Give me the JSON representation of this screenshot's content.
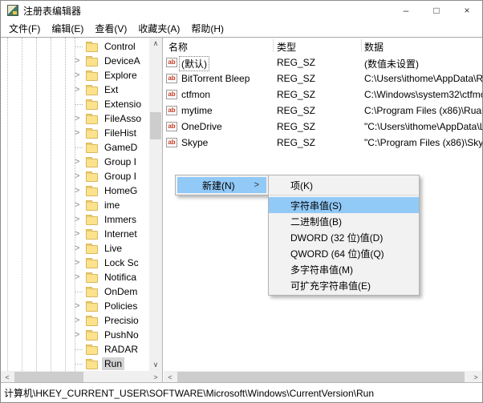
{
  "window": {
    "title": "注册表编辑器"
  },
  "icons": {
    "minimize": "–",
    "maximize": "□",
    "close": "×",
    "up": "∧",
    "down": "∨",
    "left": "<",
    "right": ">",
    "chevron": ">"
  },
  "menubar": [
    "文件(F)",
    "编辑(E)",
    "查看(V)",
    "收藏夹(A)",
    "帮助(H)"
  ],
  "tree": {
    "items": [
      {
        "label": "Control",
        "expandable": false,
        "selected": false
      },
      {
        "label": "DeviceA",
        "expandable": true,
        "selected": false
      },
      {
        "label": "Explore",
        "expandable": true,
        "selected": false
      },
      {
        "label": "Ext",
        "expandable": true,
        "selected": false
      },
      {
        "label": "Extensio",
        "expandable": false,
        "selected": false
      },
      {
        "label": "FileAsso",
        "expandable": true,
        "selected": false
      },
      {
        "label": "FileHist",
        "expandable": true,
        "selected": false
      },
      {
        "label": "GameD",
        "expandable": false,
        "selected": false
      },
      {
        "label": "Group I",
        "expandable": true,
        "selected": false
      },
      {
        "label": "Group I",
        "expandable": true,
        "selected": false
      },
      {
        "label": "HomeG",
        "expandable": true,
        "selected": false
      },
      {
        "label": "ime",
        "expandable": true,
        "selected": false
      },
      {
        "label": "Immers",
        "expandable": true,
        "selected": false
      },
      {
        "label": "Internet",
        "expandable": true,
        "selected": false
      },
      {
        "label": "Live",
        "expandable": true,
        "selected": false
      },
      {
        "label": "Lock Sc",
        "expandable": true,
        "selected": false
      },
      {
        "label": "Notifica",
        "expandable": true,
        "selected": false
      },
      {
        "label": "OnDem",
        "expandable": false,
        "selected": false
      },
      {
        "label": "Policies",
        "expandable": true,
        "selected": false
      },
      {
        "label": "Precisio",
        "expandable": true,
        "selected": false
      },
      {
        "label": "PushNo",
        "expandable": true,
        "selected": false
      },
      {
        "label": "RADAR",
        "expandable": false,
        "selected": false
      },
      {
        "label": "Run",
        "expandable": false,
        "selected": true
      }
    ]
  },
  "list": {
    "columns": [
      "名称",
      "类型",
      "数据"
    ],
    "rows": [
      {
        "name": "(默认)",
        "type": "REG_SZ",
        "data": "(数值未设置)",
        "focused": true
      },
      {
        "name": "BitTorrent Bleep",
        "type": "REG_SZ",
        "data": "C:\\Users\\ithome\\AppData\\R",
        "focused": false
      },
      {
        "name": "ctfmon",
        "type": "REG_SZ",
        "data": "C:\\Windows\\system32\\ctfmo",
        "focused": false
      },
      {
        "name": "mytime",
        "type": "REG_SZ",
        "data": "C:\\Program Files (x86)\\Ruan",
        "focused": false
      },
      {
        "name": "OneDrive",
        "type": "REG_SZ",
        "data": "\"C:\\Users\\ithome\\AppData\\L",
        "focused": false
      },
      {
        "name": "Skype",
        "type": "REG_SZ",
        "data": "\"C:\\Program Files (x86)\\Skyp",
        "focused": false
      }
    ]
  },
  "context_menu": {
    "parent_label": "新建(N)",
    "submenu": [
      {
        "label": "项(K)",
        "highlighted": false,
        "separator_before": false
      },
      {
        "label": "字符串值(S)",
        "highlighted": true,
        "separator_before": true
      },
      {
        "label": "二进制值(B)",
        "highlighted": false,
        "separator_before": false
      },
      {
        "label": "DWORD (32 位)值(D)",
        "highlighted": false,
        "separator_before": false
      },
      {
        "label": "QWORD (64 位)值(Q)",
        "highlighted": false,
        "separator_before": false
      },
      {
        "label": "多字符串值(M)",
        "highlighted": false,
        "separator_before": false
      },
      {
        "label": "可扩充字符串值(E)",
        "highlighted": false,
        "separator_before": false
      }
    ]
  },
  "statusbar": {
    "path": "计算机\\HKEY_CURRENT_USER\\SOFTWARE\\Microsoft\\Windows\\CurrentVersion\\Run"
  },
  "colors": {
    "menu_highlight": "#91c9f7",
    "selection_grey": "#d4d4d4",
    "folder_yellow": "#fce28c"
  }
}
